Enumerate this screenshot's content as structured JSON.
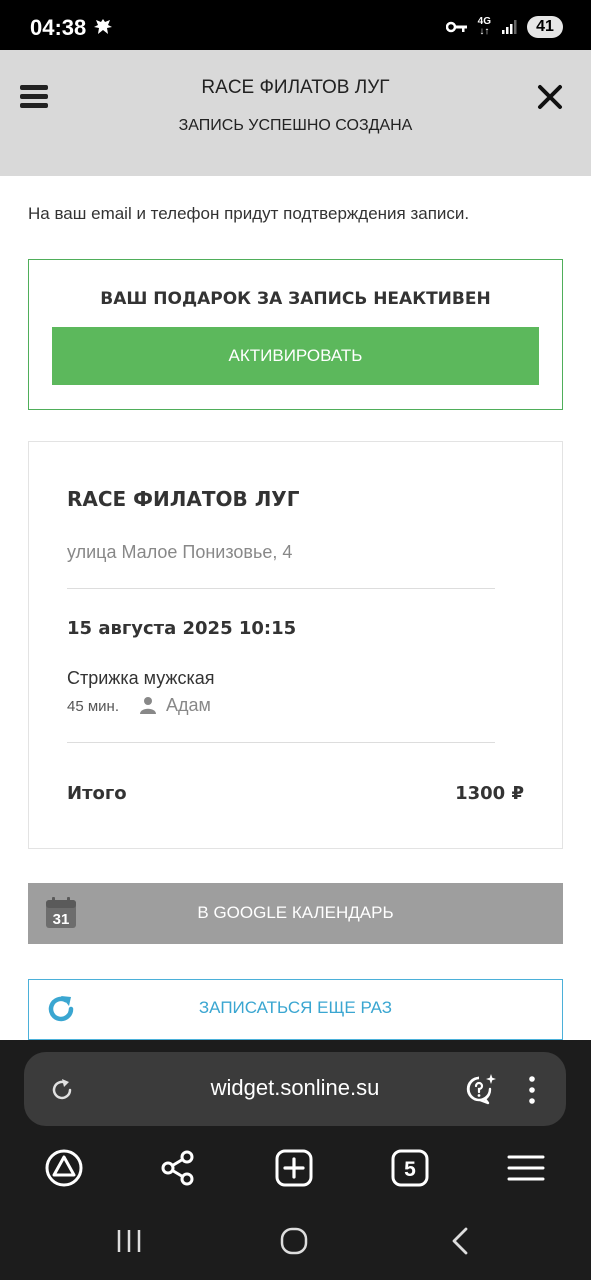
{
  "status_bar": {
    "time": "04:38",
    "network_top": "4G",
    "network_bottom": "↓↑",
    "battery": "41"
  },
  "header": {
    "title": "RACE ФИЛАТОВ ЛУГ",
    "subtitle": "ЗАПИСЬ УСПЕШНО СОЗДАНА"
  },
  "content": {
    "notice": "На ваш email и телефон придут подтверждения записи.",
    "gift": {
      "title": "ВАШ ПОДАРОК ЗА ЗАПИСЬ НЕАКТИВЕН",
      "button": "АКТИВИРОВАТЬ"
    },
    "booking": {
      "name": "RACE ФИЛАТОВ ЛУГ",
      "address": "улица Малое Понизовье, 4",
      "datetime": "15 августа 2025 10:15",
      "service": "Стрижка мужская",
      "duration": "45 мин.",
      "master": "Адам",
      "total_label": "Итого",
      "total_value": "1300 ₽"
    },
    "google_calendar_button": "В GOOGLE КАЛЕНДАРЬ",
    "calendar_icon_day": "31",
    "book_again_button": "ЗАПИСАТЬСЯ ЕЩЕ РАЗ"
  },
  "browser": {
    "url": "widget.sonline.su",
    "tab_count": "5"
  },
  "colors": {
    "green": "#5cb85c",
    "green_border": "#4fae5a",
    "blue": "#3aa6d1",
    "gray_button": "#9e9e9e",
    "header_bg": "#d9d9d9"
  },
  "icons": {
    "menu": "hamburger-menu-icon",
    "close": "close-icon",
    "person": "person-icon",
    "calendar": "google-calendar-icon",
    "refresh": "refresh-icon",
    "reload": "reload-icon",
    "assistant": "assistant-sparkle-icon",
    "more": "more-vertical-icon",
    "home": "home-icon",
    "share": "share-icon",
    "new_tab": "plus-box-icon",
    "tabs": "tabs-icon",
    "browser_menu": "hamburger-icon",
    "recents": "recents-icon",
    "system_home": "circle-home-icon",
    "back": "back-chevron-icon"
  }
}
